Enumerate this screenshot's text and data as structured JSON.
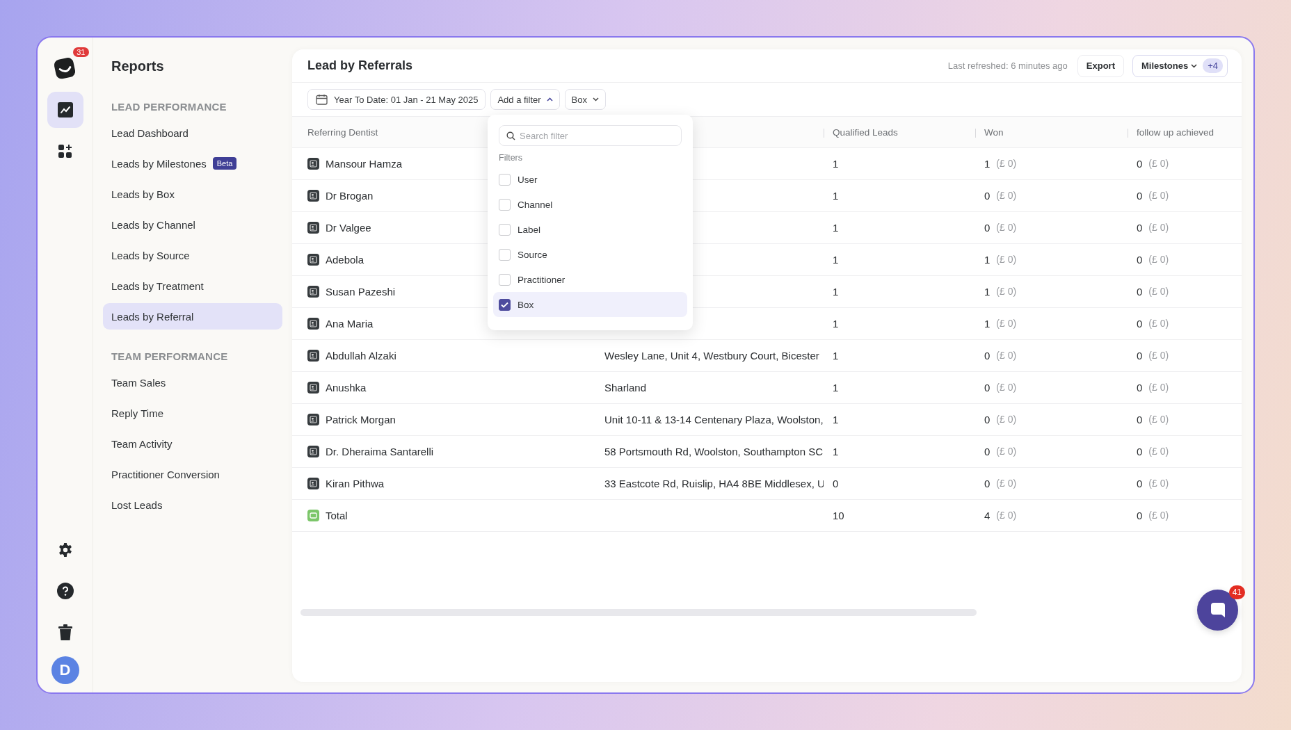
{
  "rail": {
    "logo_badge": "31",
    "items": [
      {
        "kind": "chart",
        "selected": true
      },
      {
        "kind": "apps",
        "selected": false
      }
    ],
    "bottom": [
      {
        "kind": "settings"
      },
      {
        "kind": "help"
      },
      {
        "kind": "trash"
      }
    ],
    "avatar": "D"
  },
  "sidebar": {
    "title": "Reports",
    "sections": [
      {
        "heading": "LEAD PERFORMANCE",
        "items": [
          {
            "label": "Lead Dashboard",
            "selected": false
          },
          {
            "label": "Leads by Milestones",
            "badge": "Beta",
            "selected": false
          },
          {
            "label": "Leads by Box",
            "selected": false
          },
          {
            "label": "Leads by Channel",
            "selected": false
          },
          {
            "label": "Leads by Source",
            "selected": false
          },
          {
            "label": "Leads by Treatment",
            "selected": false
          },
          {
            "label": "Leads by Referral",
            "selected": true
          }
        ]
      },
      {
        "heading": "TEAM PERFORMANCE",
        "items": [
          {
            "label": "Team Sales",
            "selected": false
          },
          {
            "label": "Reply Time",
            "selected": false
          },
          {
            "label": "Team Activity",
            "selected": false
          },
          {
            "label": "Practitioner Conversion",
            "selected": false
          },
          {
            "label": "Lost Leads",
            "selected": false
          }
        ]
      }
    ]
  },
  "main": {
    "title": "Lead by Referrals",
    "last_refreshed": "Last refreshed: 6 minutes ago",
    "export": "Export",
    "milestones": {
      "label": "Milestones",
      "count": "+4"
    },
    "filters": {
      "date": "Year To Date: 01 Jan - 21 May 2025",
      "add": "Add a filter",
      "box": "Box"
    }
  },
  "dropdown": {
    "placeholder": "Search filter",
    "heading": "Filters",
    "options": [
      {
        "label": "User",
        "checked": false,
        "selected": false
      },
      {
        "label": "Channel",
        "checked": false,
        "selected": false
      },
      {
        "label": "Label",
        "checked": false,
        "selected": false
      },
      {
        "label": "Source",
        "checked": false,
        "selected": false
      },
      {
        "label": "Practitioner",
        "checked": false,
        "selected": false
      },
      {
        "label": "Box",
        "checked": true,
        "selected": true
      }
    ]
  },
  "table": {
    "columns": [
      "Referring Dentist",
      "Qualified Leads",
      "Won",
      "follow up achieved"
    ],
    "rows": [
      {
        "kind": "dentist",
        "name": "Mansour Hamza",
        "qualified": "1",
        "won": "1",
        "won_amount": "(£ 0)",
        "follow": "0",
        "follow_amount": "(£ 0)"
      },
      {
        "kind": "dentist",
        "name": "Dr Brogan",
        "qualified": "1",
        "won": "0",
        "won_amount": "(£ 0)",
        "follow": "0",
        "follow_amount": "(£ 0)"
      },
      {
        "kind": "dentist",
        "name": "Dr Valgee",
        "qualified": "1",
        "won": "0",
        "won_amount": "(£ 0)",
        "follow": "0",
        "follow_amount": "(£ 0)"
      },
      {
        "kind": "dentist",
        "name": "Adebola",
        "qualified": "1",
        "won": "1",
        "won_amount": "(£ 0)",
        "follow": "0",
        "follow_amount": "(£ 0)"
      },
      {
        "kind": "dentist",
        "name": "Susan Pazeshi",
        "qualified": "1",
        "won": "1",
        "won_amount": "(£ 0)",
        "follow": "0",
        "follow_amount": "(£ 0)"
      },
      {
        "kind": "dentist",
        "name": "Ana Maria",
        "qualified": "1",
        "won": "1",
        "won_amount": "(£ 0)",
        "follow": "0",
        "follow_amount": "(£ 0)"
      },
      {
        "kind": "dentist",
        "name": "Abdullah Alzaki",
        "column_2": "Wesley Lane, Unit 4, Westbury Court, Bicester",
        "qualified": "1",
        "won": "0",
        "won_amount": "(£ 0)",
        "follow": "0",
        "follow_amount": "(£ 0)"
      },
      {
        "kind": "dentist",
        "name": "Anushka",
        "column_2": "Sharland",
        "qualified": "1",
        "won": "0",
        "won_amount": "(£ 0)",
        "follow": "0",
        "follow_amount": "(£ 0)"
      },
      {
        "kind": "dentist",
        "name": "Patrick Morgan",
        "column_2": "Unit 10-11 & 13-14 Centenary Plaza, Woolston,",
        "qualified": "1",
        "won": "0",
        "won_amount": "(£ 0)",
        "follow": "0",
        "follow_amount": "(£ 0)"
      },
      {
        "kind": "dentist",
        "name": "Dr. Dheraima Santarelli",
        "column_2": "58 Portsmouth Rd, Woolston, Southampton SC",
        "qualified": "1",
        "won": "0",
        "won_amount": "(£ 0)",
        "follow": "0",
        "follow_amount": "(£ 0)"
      },
      {
        "kind": "dentist",
        "name": "Kiran Pithwa",
        "column_2": "33 Eastcote Rd, Ruislip, HA4 8BE Middlesex, U",
        "qualified": "0",
        "won": "0",
        "won_amount": "(£ 0)",
        "follow": "0",
        "follow_amount": "(£ 0)"
      },
      {
        "kind": "total",
        "name": "Total",
        "qualified": "10",
        "won": "4",
        "won_amount": "(£ 0)",
        "follow": "0",
        "follow_amount": "(£ 0)"
      }
    ]
  },
  "chat": {
    "badge": "41"
  }
}
